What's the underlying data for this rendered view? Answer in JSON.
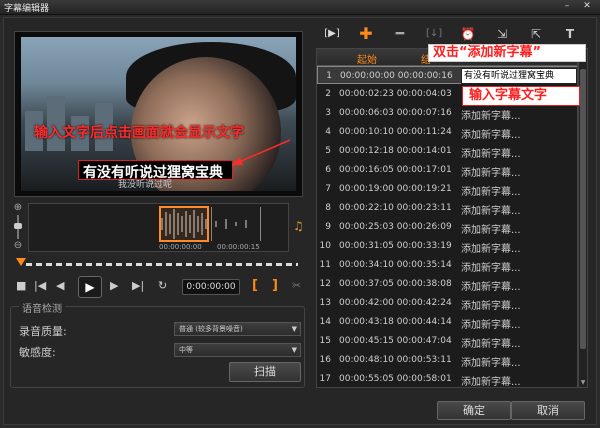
{
  "window": {
    "title": "字幕编辑器",
    "minimize": "–",
    "close": "✕"
  },
  "preview": {
    "subtitle_text": "有没有听说过狸窝宝典",
    "subtitle_small": "我没听说过呢",
    "annotation": "输入文字后点击画面就会显示文字"
  },
  "timeline": {
    "wave_tick1": "00:00:00:00",
    "wave_tick2": "00:00:00:15",
    "zoom_in_icon": "zoom-in",
    "zoom_out_icon": "zoom-out"
  },
  "transport": {
    "timecode": "0:00:00:00"
  },
  "voice_detection": {
    "legend": "语音检测",
    "quality_label": "录音质量:",
    "quality_value": "普通 (较多背景噪音)",
    "sensitivity_label": "敏感度:",
    "sensitivity_value": "中等",
    "scan_button": "扫描"
  },
  "subtitle_list": {
    "col_start": "起始",
    "col_end": "结",
    "rows": [
      {
        "n": "1",
        "time": "00:00:00:00 00:00:00:16",
        "text": ""
      },
      {
        "n": "2",
        "time": "00:00:02:23 00:00:04:03",
        "text": ""
      },
      {
        "n": "3",
        "time": "00:00:06:03 00:00:07:16",
        "text": "添加新字幕..."
      },
      {
        "n": "4",
        "time": "00:00:10:10 00:00:11:24",
        "text": "添加新字幕..."
      },
      {
        "n": "5",
        "time": "00:00:12:18 00:00:14:01",
        "text": "添加新字幕..."
      },
      {
        "n": "6",
        "time": "00:00:16:05 00:00:17:01",
        "text": "添加新字幕..."
      },
      {
        "n": "7",
        "time": "00:00:19:00 00:00:19:21",
        "text": "添加新字幕..."
      },
      {
        "n": "8",
        "time": "00:00:22:10 00:00:23:11",
        "text": "添加新字幕..."
      },
      {
        "n": "9",
        "time": "00:00:25:03 00:00:26:09",
        "text": "添加新字幕..."
      },
      {
        "n": "10",
        "time": "00:00:31:05 00:00:33:19",
        "text": "添加新字幕..."
      },
      {
        "n": "11",
        "time": "00:00:34:10 00:00:35:14",
        "text": "添加新字幕..."
      },
      {
        "n": "12",
        "time": "00:00:37:05 00:00:38:08",
        "text": "添加新字幕..."
      },
      {
        "n": "13",
        "time": "00:00:42:00 00:00:42:24",
        "text": "添加新字幕..."
      },
      {
        "n": "14",
        "time": "00:00:43:18 00:00:44:14",
        "text": "添加新字幕..."
      },
      {
        "n": "15",
        "time": "00:00:45:15 00:00:47:04",
        "text": "添加新字幕..."
      },
      {
        "n": "16",
        "time": "00:00:48:10 00:00:53:11",
        "text": "添加新字幕..."
      },
      {
        "n": "17",
        "time": "00:00:55:05 00:00:58:01",
        "text": "添加新字幕..."
      }
    ],
    "edit_value": "有没有听说过狸窝宝典"
  },
  "annotations": {
    "double_click": "双击“添加新字幕”",
    "input_text": "输入字幕文字"
  },
  "buttons": {
    "ok": "确定",
    "cancel": "取消"
  },
  "colors": {
    "accent": "#ff8a1a",
    "annotation": "#ff1f1f"
  }
}
